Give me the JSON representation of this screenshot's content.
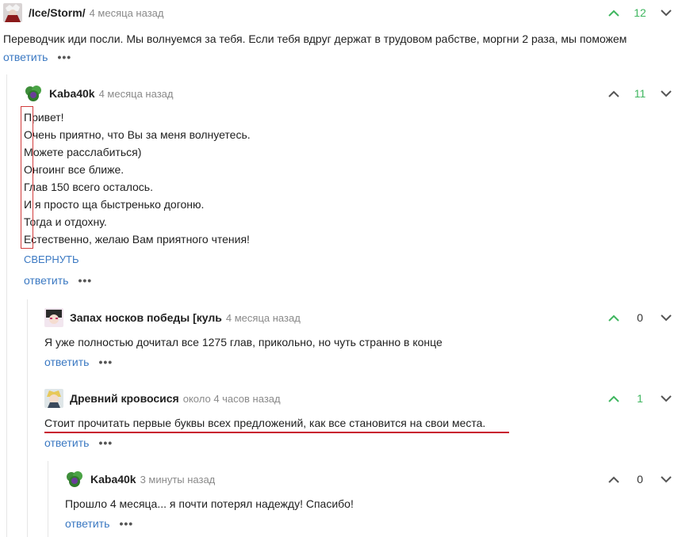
{
  "comments": [
    {
      "username": "/Ice/Storm/",
      "time": "4 месяца назад",
      "votes": "12",
      "vote_color": "#3fb65f",
      "lines": [
        "Переводчик иди посли. Мы волнуемся за тебя. Если тебя вдруг держат в трудовом рабстве, моргни 2 раза, мы поможем"
      ],
      "reply_label": "ответить"
    },
    {
      "username": "Kaba40k",
      "time": "4 месяца назад",
      "votes": "11",
      "vote_color": "#3fb65f",
      "lines": [
        "Привет!",
        "Очень приятно, что Вы за меня волнуетесь.",
        "Можете расслабиться)",
        "Онгоинг все ближе.",
        "Глав 150 всего осталось.",
        "И я просто ща быстренько догоню.",
        "Тогда и отдохну.",
        "Естественно, желаю Вам приятного чтения!"
      ],
      "collapse_label": "СВЕРНУТЬ",
      "reply_label": "ответить"
    },
    {
      "username": "Запах носков победы [куль",
      "time": "4 месяца назад",
      "votes": "0",
      "vote_color": "#333333",
      "lines": [
        "Я уже полностью дочитал все 1275 глав, прикольно, но чуть странно в конце"
      ],
      "reply_label": "ответить"
    },
    {
      "username": "Древний кровосися",
      "time": "около 4 часов назад",
      "votes": "1",
      "vote_color": "#3fb65f",
      "lines": [
        "Стоит прочитать первые буквы всех предложений, как все становится на свои места."
      ],
      "reply_label": "ответить"
    },
    {
      "username": "Kaba40k",
      "time": "3 минуты назад",
      "votes": "0",
      "vote_color": "#333333",
      "lines": [
        "Прошло 4 месяца... я почти потерял надежду! Спасибо!"
      ],
      "reply_label": "ответить"
    }
  ],
  "colors": {
    "link": "#3a78c2",
    "upvote_active": "#3fb65f",
    "annotation_red": "#c8102e"
  }
}
